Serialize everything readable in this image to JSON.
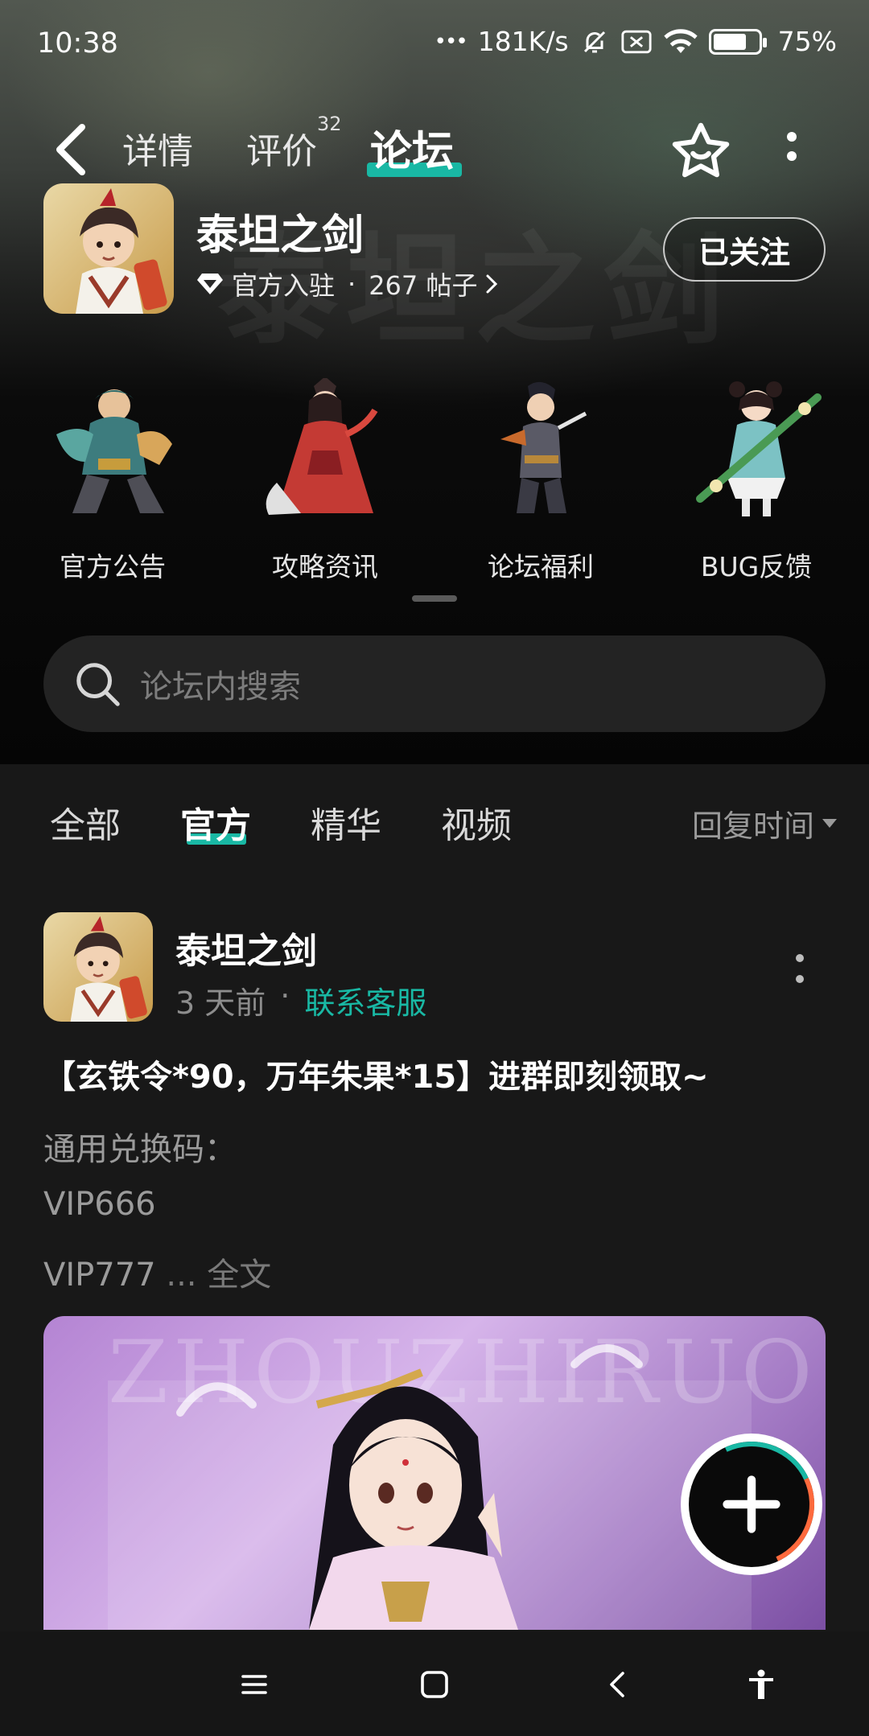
{
  "status_bar": {
    "time": "10:38",
    "dots": "•••",
    "network_speed": "181K/s",
    "battery": "75%",
    "battery_level": 0.75
  },
  "nav": {
    "tabs": {
      "detail": "详情",
      "review": "评价",
      "review_count": "32",
      "forum": "论坛"
    }
  },
  "game": {
    "name": "泰坦之剑",
    "badge": "官方入驻",
    "separator": "·",
    "posts": "267 帖子",
    "follow_label": "已关注",
    "watermark": "泰坦之剑"
  },
  "categories": [
    {
      "label": "官方公告"
    },
    {
      "label": "攻略资讯"
    },
    {
      "label": "论坛福利"
    },
    {
      "label": "BUG反馈"
    }
  ],
  "search": {
    "placeholder": "论坛内搜索"
  },
  "filters": {
    "tabs": [
      "全部",
      "官方",
      "精华",
      "视频"
    ],
    "active": "官方",
    "sort_label": "回复时间"
  },
  "post": {
    "author": "泰坦之剑",
    "time": "3 天前",
    "separator": "·",
    "contact": "联系客服",
    "title": "【玄铁令*90，万年朱果*15】进群即刻领取~",
    "lines": [
      "通用兑换码：",
      "VIP666",
      "VIP777"
    ],
    "ellipsis": " ... ",
    "fulltext": "全文",
    "image_watermark": "ZHOUZHIRUO"
  },
  "colors": {
    "accent": "#19b8a4",
    "background": "#181818"
  },
  "icons": {
    "back": "chevron-left-icon",
    "favorite": "star-icon",
    "more": "more-vertical-icon",
    "search": "search-icon",
    "fab": "plus-icon"
  }
}
